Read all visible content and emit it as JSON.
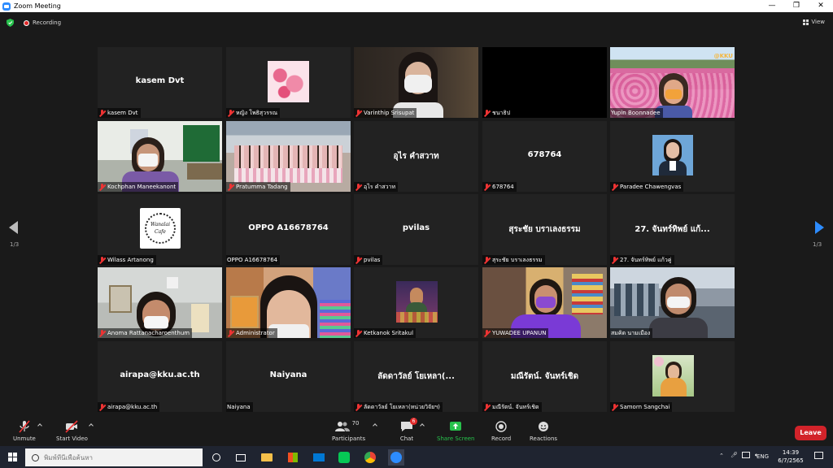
{
  "window": {
    "title": "Zoom Meeting",
    "controls": [
      "—",
      "❐",
      "✕"
    ]
  },
  "topbar": {
    "recording": "Recording",
    "view": "View"
  },
  "gallery": {
    "page_left": "1/3",
    "page_right": "1/3",
    "tiles": [
      {
        "name": "kasem Dvt",
        "center": "kasem Dvt"
      },
      {
        "name": "หญิง โพธิสุวรรณ",
        "center": ""
      },
      {
        "name": "Varinthip Srisupat",
        "center": ""
      },
      {
        "name": "ชนาธิป",
        "center": ""
      },
      {
        "name": "Yupin Boonnadee",
        "center": ""
      },
      {
        "name": "Kochphan Maneekanont",
        "center": ""
      },
      {
        "name": "Pratumma Tadang",
        "center": ""
      },
      {
        "name": "อุไร คำสวาท",
        "center": "อุไร คำสวาท"
      },
      {
        "name": "678764",
        "center": "678764"
      },
      {
        "name": "Paradee Chawengvas",
        "center": ""
      },
      {
        "name": "Wilass Artanong",
        "center": ""
      },
      {
        "name": "OPPO A16678764",
        "center": "OPPO A16678764"
      },
      {
        "name": "pvilas",
        "center": "pvilas"
      },
      {
        "name": "สุระชัย บราเลงธรรม",
        "center": "สุระชัย บราเลงธรรม"
      },
      {
        "name": "27. จันทร์ทิพย์ แก้วคู่",
        "center": "27. จันทร์ทิพย์ แก้..."
      },
      {
        "name": "Anoma Rattanacharoenthum",
        "center": ""
      },
      {
        "name": "Administrator",
        "center": ""
      },
      {
        "name": "Ketkanok Sritakul",
        "center": ""
      },
      {
        "name": "YUWADEE UPANUN",
        "center": ""
      },
      {
        "name": "สมคิด นามเมือง",
        "center": ""
      },
      {
        "name": "airapa@kku.ac.th",
        "center": "airapa@kku.ac.th"
      },
      {
        "name": "Naiyana",
        "center": "Naiyana"
      },
      {
        "name": "ลัดดาวัลย์ โยเหลา(หน่วยวิจัยฯ)",
        "center": "ลัดดาวัลย์ โยเหลา(..."
      },
      {
        "name": "มณีรัตน์. จันทร์เชิด",
        "center": "มณีรัตน์. จันทร์เชิด"
      },
      {
        "name": "Samorn Sangchai",
        "center": ""
      }
    ],
    "logo_text": "Wanalai Cafe",
    "watermark": "@KKU"
  },
  "controls": {
    "unmute": "Unmute",
    "start_video": "Start Video",
    "participants": "Participants",
    "participants_count": "70",
    "chat": "Chat",
    "chat_badge": "6",
    "share_screen": "Share Screen",
    "record": "Record",
    "reactions": "Reactions",
    "leave": "Leave"
  },
  "taskbar": {
    "search_placeholder": "พิมพ์ที่นี่เพื่อค้นหา",
    "lang": "ENG",
    "time": "14:39",
    "date": "6/7/2565"
  },
  "colors": {
    "accent": "#2d8cff",
    "leave": "#d2232a",
    "share": "#27c24c",
    "active_border": "#e5e59b"
  }
}
